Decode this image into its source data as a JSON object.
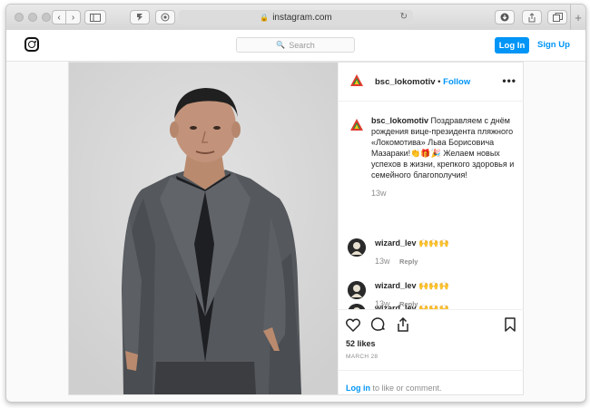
{
  "browser": {
    "url": "instagram.com"
  },
  "header": {
    "search_placeholder": "Search",
    "login_label": "Log In",
    "signup_label": "Sign Up"
  },
  "post": {
    "username": "bsc_lokomotiv",
    "follow_label": "Follow",
    "separator": "•",
    "caption_text": "Поздравляем с днём рождения вице-президента пляжного «Локомотива» Льва Борисовича Мазараки!👏🎁🎉 Желаем новых успехов в жизни, крепкого здоровья и семейного благополучия!",
    "caption_time": "13w",
    "comments": [
      {
        "username": "wizard_lev",
        "text": "🙌🙌🙌",
        "time": "13w",
        "reply": "Reply"
      },
      {
        "username": "wizard_lev",
        "text": "🙌🙌🙌",
        "time": "13w",
        "reply": "Reply"
      },
      {
        "username": "wizard_lev",
        "text": "🙌🙌🙌",
        "time": "",
        "reply": ""
      }
    ],
    "likes": "52 likes",
    "date": "MARCH 28",
    "login_link": "Log in",
    "login_suffix": " to like or comment."
  },
  "colors": {
    "accent": "#0095f6",
    "text": "#262626",
    "muted": "#8e8e8e"
  },
  "icons": {
    "heart": "heart-icon",
    "comment": "comment-icon",
    "share": "share-icon",
    "bookmark": "bookmark-icon"
  }
}
